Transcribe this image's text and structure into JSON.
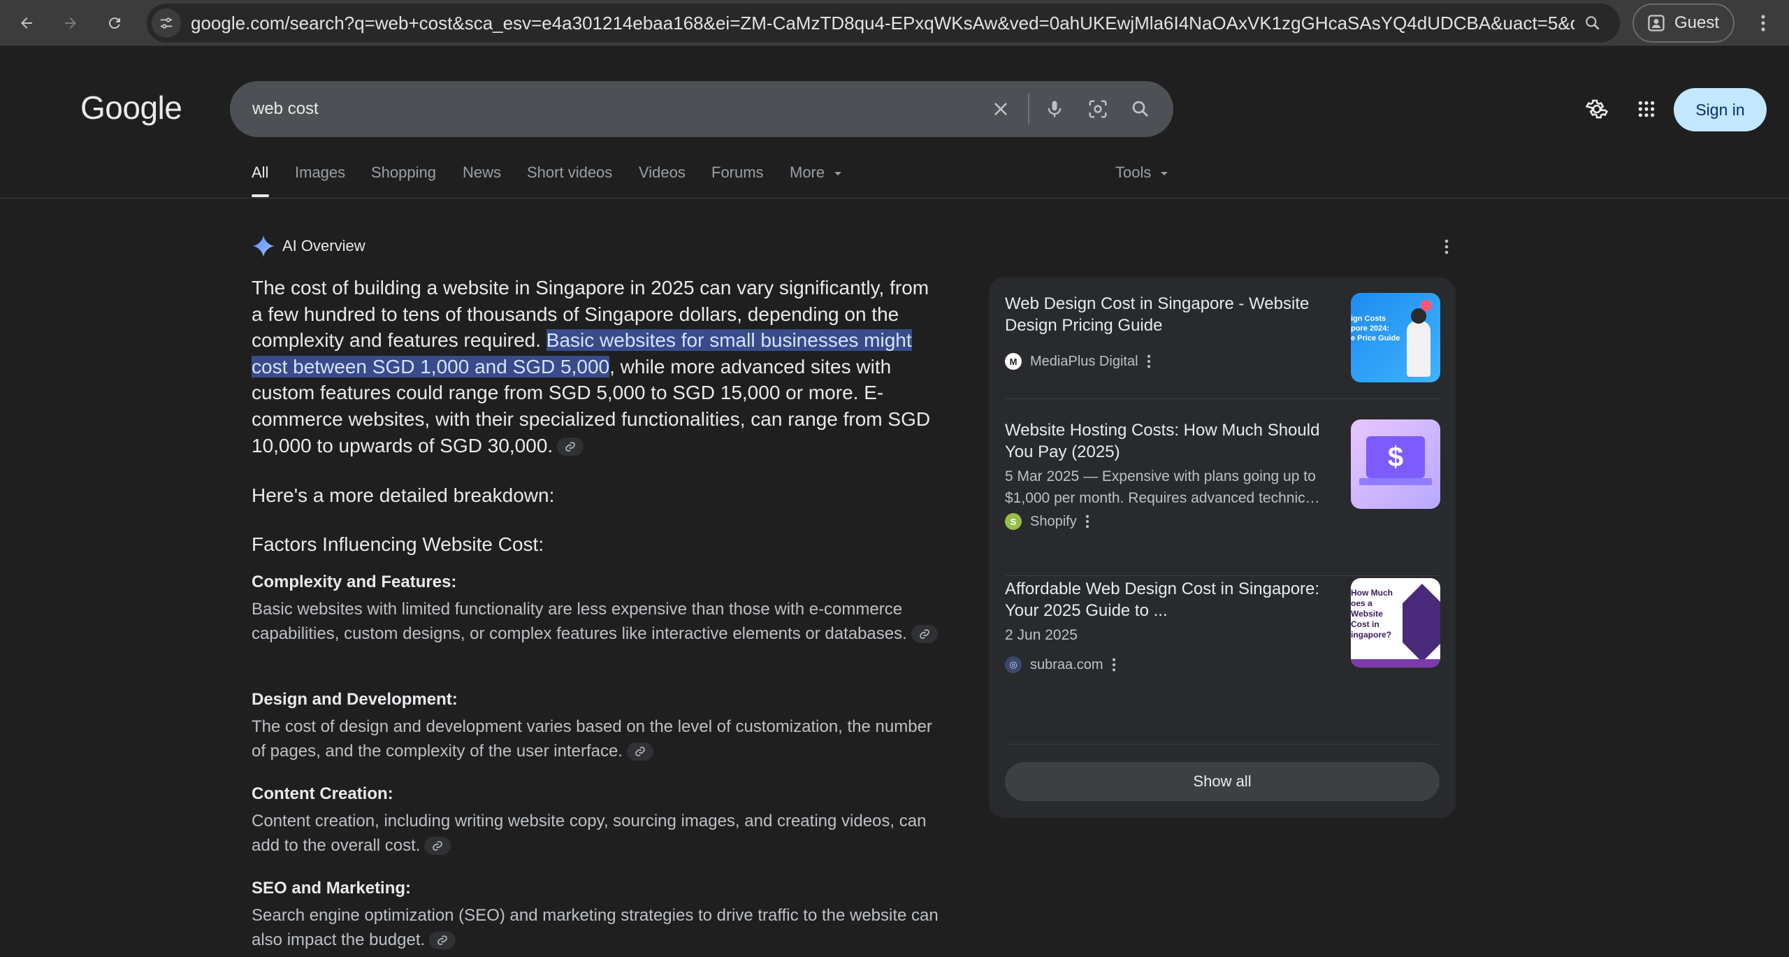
{
  "browser": {
    "url": "google.com/search?q=web+cost&sca_esv=e4a301214ebaa168&ei=ZM-CaMzTD8qu4-EPxqWKsAw&ved=0ahUKEwjMla6I4NaOAxVK1zgGHcaSAsYQ4dUDCBA&uact=5&o...",
    "profile_label": "Guest"
  },
  "header": {
    "logo": "Google",
    "search_query": "web cost",
    "signin_label": "Sign in"
  },
  "tabs": [
    {
      "label": "All"
    },
    {
      "label": "Images"
    },
    {
      "label": "Shopping"
    },
    {
      "label": "News"
    },
    {
      "label": "Short videos"
    },
    {
      "label": "Videos"
    },
    {
      "label": "Forums"
    },
    {
      "label": "More"
    }
  ],
  "tools_label": "Tools",
  "ai_overview": {
    "heading": "AI Overview",
    "lead_part1": "The cost of building a website in Singapore in 2025 can vary significantly, from a few hundred to tens of thousands of Singapore dollars, depending on the complexity and features required. ",
    "lead_highlight": "Basic websites for small businesses might cost between SGD 1,000 and SGD 5,000",
    "lead_part2": ", while more advanced sites with custom features could range from SGD 5,000 to SGD 15,000 or more. E-commerce websites, with their specialized functionalities, can range from SGD 10,000 to upwards of SGD 30,000.",
    "breakdown_intro": "Here's a more detailed breakdown:",
    "factors_heading": "Factors Influencing Website Cost:",
    "sections": [
      {
        "title": "Complexity and Features:",
        "text": "Basic websites with limited functionality are less expensive than those with e-commerce capabilities, custom designs, or complex features like interactive elements or databases."
      },
      {
        "title": "Design and Development:",
        "text": "The cost of design and development varies based on the level of customization, the number of pages, and the complexity of the user interface."
      },
      {
        "title": "Content Creation:",
        "text": "Content creation, including writing website copy, sourcing images, and creating videos, can add to the overall cost."
      },
      {
        "title": "SEO and Marketing:",
        "text": "Search engine optimization (SEO) and marketing strategies to drive traffic to the website can also impact the budget."
      }
    ]
  },
  "sources": {
    "items": [
      {
        "title": "Web Design Cost in Singapore - Website Design Pricing Guide",
        "snippet": "",
        "site": "MediaPlus Digital",
        "thumb_text": "ign Costs\npore 2024:\ne Price Guide"
      },
      {
        "title": "Website Hosting Costs: How Much Should You Pay (2025)",
        "snippet": "5 Mar 2025 — Expensive with plans going up to $1,000 per month. Requires advanced technic…",
        "site": "Shopify",
        "thumb_text": "$"
      },
      {
        "title": "Affordable Web Design Cost in Singapore: Your 2025 Guide to ...",
        "snippet": "2 Jun 2025",
        "site": "subraa.com",
        "thumb_text": "How Much\noes a\nWebsite\nCost in\ningapore?"
      }
    ],
    "show_all_label": "Show all"
  },
  "colors": {
    "background": "#1f1f1f",
    "highlight": "#394b8a",
    "signin_bg": "#c2e7ff"
  }
}
